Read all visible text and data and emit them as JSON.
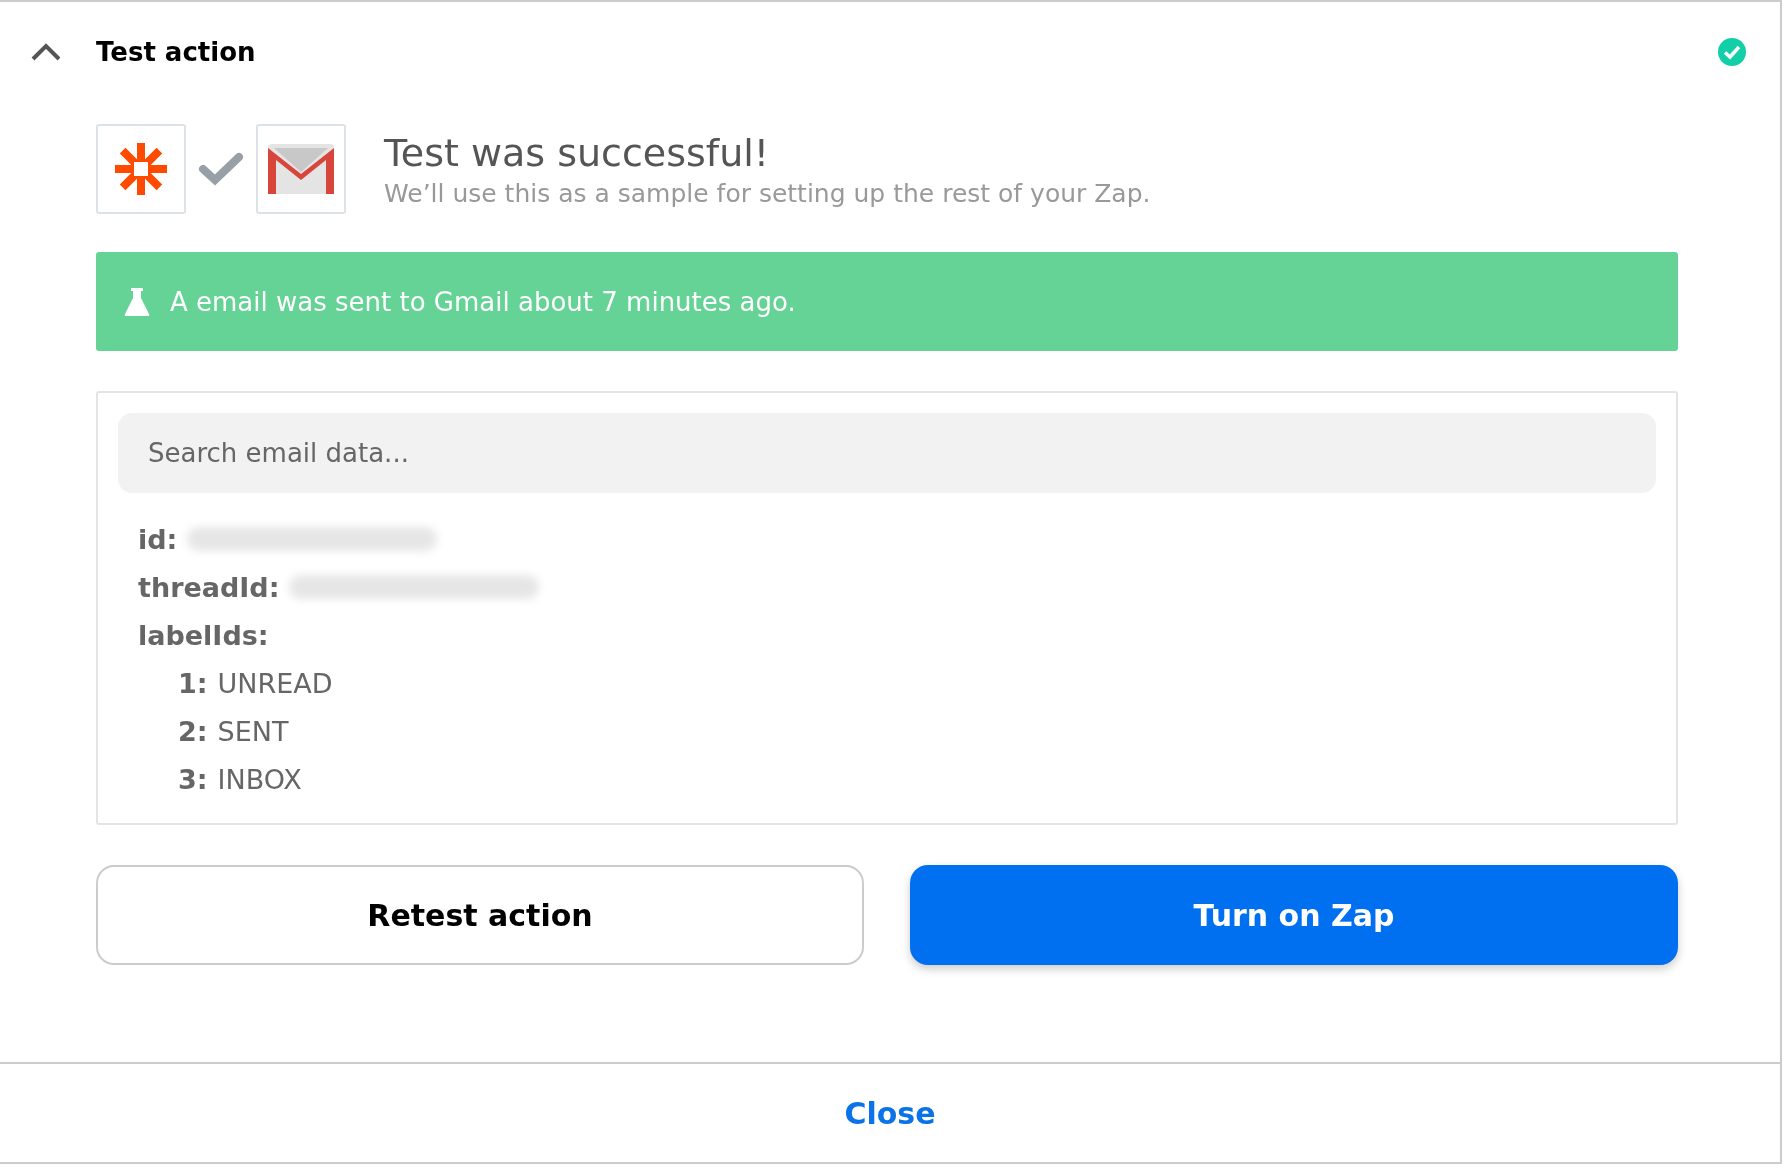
{
  "section": {
    "title": "Test action",
    "expanded": true,
    "complete": true
  },
  "result": {
    "title": "Test was successful!",
    "subtitle": "We’ll use this as a sample for setting up the rest of your Zap."
  },
  "banner": {
    "message": "A email was sent to Gmail about 7 minutes ago."
  },
  "data": {
    "search": {
      "placeholder": "Search email data..."
    },
    "fields": [
      {
        "key": "id:",
        "kind": "redacted"
      },
      {
        "key": "threadId:",
        "kind": "redacted"
      },
      {
        "key": "labelIds:",
        "kind": "list",
        "items": [
          {
            "key": "1:",
            "value": "UNREAD"
          },
          {
            "key": "2:",
            "value": "SENT"
          },
          {
            "key": "3:",
            "value": "INBOX"
          }
        ]
      }
    ]
  },
  "buttons": [
    {
      "label": "Retest action",
      "kind": "secondary"
    },
    {
      "label": "Turn on Zap",
      "kind": "primary"
    }
  ],
  "footer": {
    "link": "Close"
  }
}
